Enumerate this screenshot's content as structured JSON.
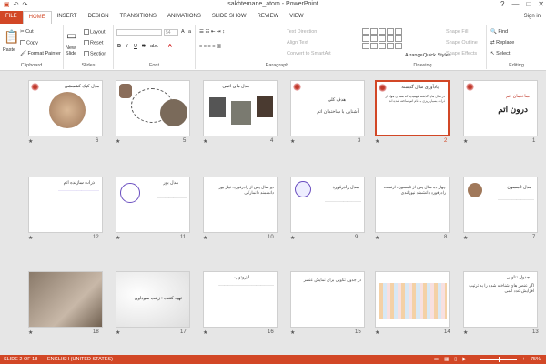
{
  "window": {
    "title": "sakhtemane_atom - PowerPoint",
    "controls": [
      "?",
      "—",
      "□",
      "✕"
    ]
  },
  "tabs": [
    "FILE",
    "HOME",
    "INSERT",
    "DESIGN",
    "TRANSITIONS",
    "ANIMATIONS",
    "SLIDE SHOW",
    "REVIEW",
    "VIEW"
  ],
  "signin": "Sign in",
  "ribbon": {
    "clipboard": {
      "label": "Clipboard",
      "paste": "Paste",
      "cut": "Cut",
      "copy": "Copy",
      "format_painter": "Format Painter"
    },
    "slides": {
      "label": "Slides",
      "new_slide": "New Slide",
      "layout": "Layout",
      "reset": "Reset",
      "section": "Section"
    },
    "font": {
      "label": "Font",
      "size": "54",
      "bold": "B",
      "italic": "I",
      "underline": "U",
      "strike": "S",
      "shadow": "abc"
    },
    "paragraph": {
      "label": "Paragraph",
      "text_direction": "Text Direction",
      "align_text": "Align Text",
      "smartart": "Convert to SmartArt"
    },
    "drawing": {
      "label": "Drawing",
      "arrange": "Arrange",
      "quick_styles": "Quick Styles",
      "shape_fill": "Shape Fill",
      "shape_outline": "Shape Outline",
      "shape_effects": "Shape Effects"
    },
    "editing": {
      "label": "Editing",
      "find": "Find",
      "replace": "Replace",
      "select": "Select"
    }
  },
  "slides": [
    {
      "n": "1",
      "title": "ساختمان اتم",
      "subtitle": "درون اتم",
      "star": "★"
    },
    {
      "n": "2",
      "title": "یادآوری سال گذشته",
      "body": "در سال های گذشته فهمیدید که همه ی مواد از ذرات بسیار ریزی به نام اتم ساخته شده اند",
      "star": "★",
      "selected": true
    },
    {
      "n": "3",
      "title": "هدف کلی",
      "body": "آشنایی با ساختمان اتم",
      "star": "★"
    },
    {
      "n": "4",
      "title": "مدل های اتمی",
      "body": "",
      "star": "★"
    },
    {
      "n": "5",
      "title": "",
      "body": "",
      "star": "★"
    },
    {
      "n": "6",
      "title": "مدل کیک کشمشی",
      "body": "",
      "star": "★"
    },
    {
      "n": "7",
      "title": "مدل تامسون",
      "body": "",
      "star": "★"
    },
    {
      "n": "8",
      "title": "",
      "body": "چهار ده سال پس از تامسون، ارنست رادرفورد دانشمند نیوزلندی",
      "star": "★"
    },
    {
      "n": "9",
      "title": "مدل رادرفورد",
      "body": "",
      "star": "★"
    },
    {
      "n": "10",
      "title": "",
      "body": "دو سال پس از رادرفورد، نیلز بور دانشمند دانمارکی",
      "star": "★"
    },
    {
      "n": "11",
      "title": "مدل بور",
      "body": "",
      "star": "★"
    },
    {
      "n": "12",
      "title": "ذرات سازنده اتم",
      "body": "",
      "star": "★"
    },
    {
      "n": "13",
      "title": "جدول تناوبی",
      "body": "اگر عنصر های شناخته شده را به ترتیب افزایش عدد اتمی",
      "star": "★"
    },
    {
      "n": "14",
      "title": "",
      "body": "",
      "star": "★"
    },
    {
      "n": "15",
      "title": "",
      "body": "در جدول تناوبی برای نمایش عنصر",
      "star": "★"
    },
    {
      "n": "16",
      "title": "ایزوتوپ",
      "body": "",
      "star": "★"
    },
    {
      "n": "17",
      "title": "تهیه کننده : زینب سوداوی",
      "body": "",
      "star": "★"
    },
    {
      "n": "18",
      "title": "",
      "body": "",
      "star": "★"
    }
  ],
  "status": {
    "slide": "SLIDE 2 OF 18",
    "lang": "ENGLISH (UNITED STATES)",
    "zoom": "75%"
  },
  "colors": {
    "accent": "#d24726"
  }
}
